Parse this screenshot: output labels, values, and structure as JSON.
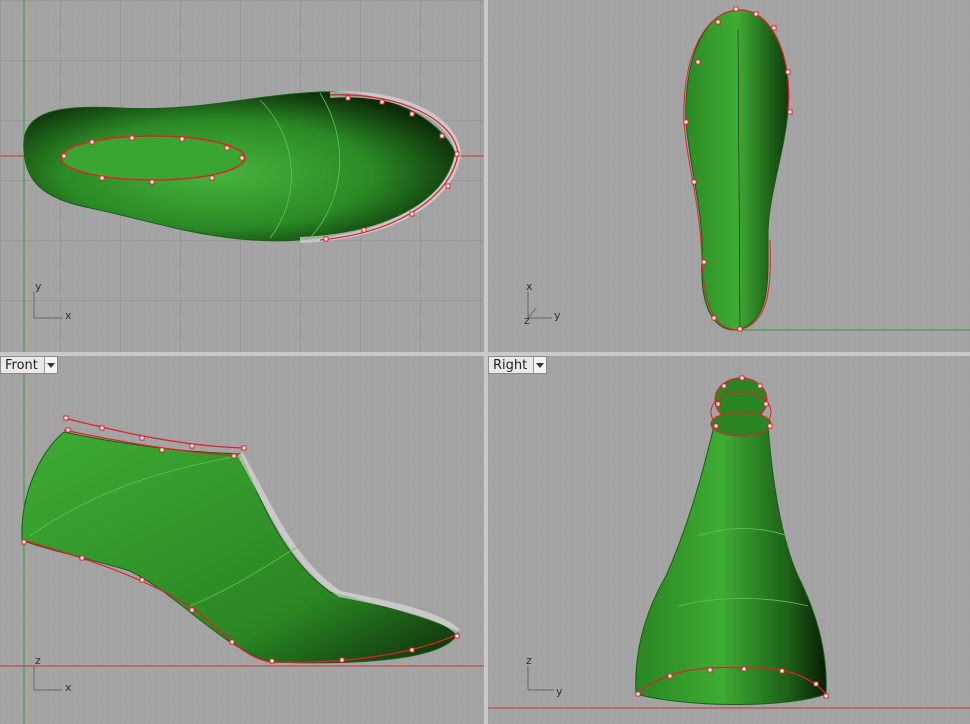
{
  "viewports": {
    "top": {
      "label": "",
      "axis_h": "x",
      "axis_v": "y"
    },
    "perspective": {
      "label": "",
      "axis_h": "y",
      "axis_v": "x",
      "axis_z": "z"
    },
    "front": {
      "label": "Front",
      "axis_h": "x",
      "axis_v": "z"
    },
    "right": {
      "label": "Right",
      "axis_h": "y",
      "axis_v": "z"
    }
  },
  "colors": {
    "background": "#a4a4a4",
    "grid_minor": "#9a9a9a",
    "grid_major": "#8c8c8c",
    "x_axis": "#c0392b",
    "y_axis": "#2e9b3a",
    "model_green": "#2f8f2a",
    "control_curve": "#e0202a"
  }
}
